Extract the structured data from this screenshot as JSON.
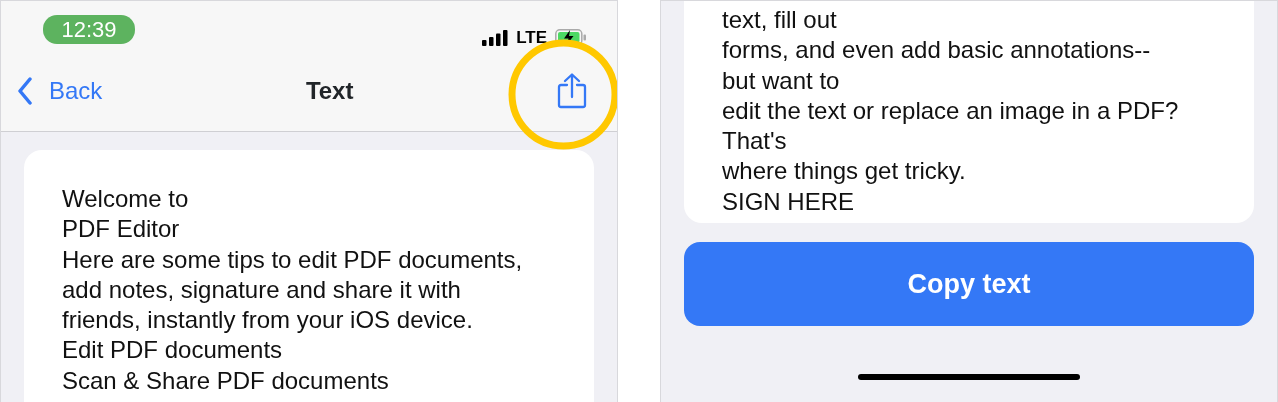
{
  "screens": [
    {
      "status_bar": {
        "time": "12:39",
        "network": "LTE"
      },
      "nav": {
        "back": "Back",
        "title": "Text"
      },
      "highlight": {
        "circled": true
      },
      "text_lines": [
        "Welcome to",
        "PDF Editor",
        "Here are some tips to edit PDF documents,",
        "add notes, signature and share it with",
        "friends, instantly from your iOS device.",
        "Edit PDF documents",
        "Scan & Share PDF documents"
      ]
    },
    {
      "text_lines": [
        "text, fill out",
        "forms, and even add basic annotations--",
        "but want to",
        "edit the text or replace an image in a PDF?",
        "That's",
        "where things get tricky.",
        "SIGN HERE"
      ],
      "button": "Copy text"
    }
  ]
}
